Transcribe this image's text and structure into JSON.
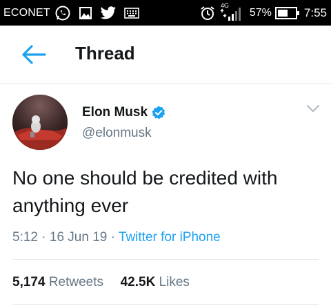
{
  "status_bar": {
    "carrier": "ECONET",
    "network_type": "4G",
    "battery_percent": "57%",
    "time": "7:55",
    "icons": [
      "whatsapp-icon",
      "gallery-icon",
      "twitter-icon",
      "keyboard-icon",
      "alarm-icon",
      "signal-icon",
      "battery-icon"
    ]
  },
  "header": {
    "title": "Thread",
    "back_icon": "arrow-left-icon"
  },
  "tweet": {
    "author_name": "Elon Musk",
    "author_handle": "@elonmusk",
    "verified": true,
    "text": "No one should be credited with anything ever",
    "time": "5:12",
    "separator": "·",
    "date": "16 Jun 19",
    "source": "Twitter for iPhone",
    "retweets_count": "5,174",
    "retweets_label": "Retweets",
    "likes_count": "42.5K",
    "likes_label": "Likes"
  },
  "colors": {
    "accent": "#1da1f2",
    "text_primary": "#14171a",
    "text_secondary": "#657786",
    "divider": "#e1e8ed"
  }
}
